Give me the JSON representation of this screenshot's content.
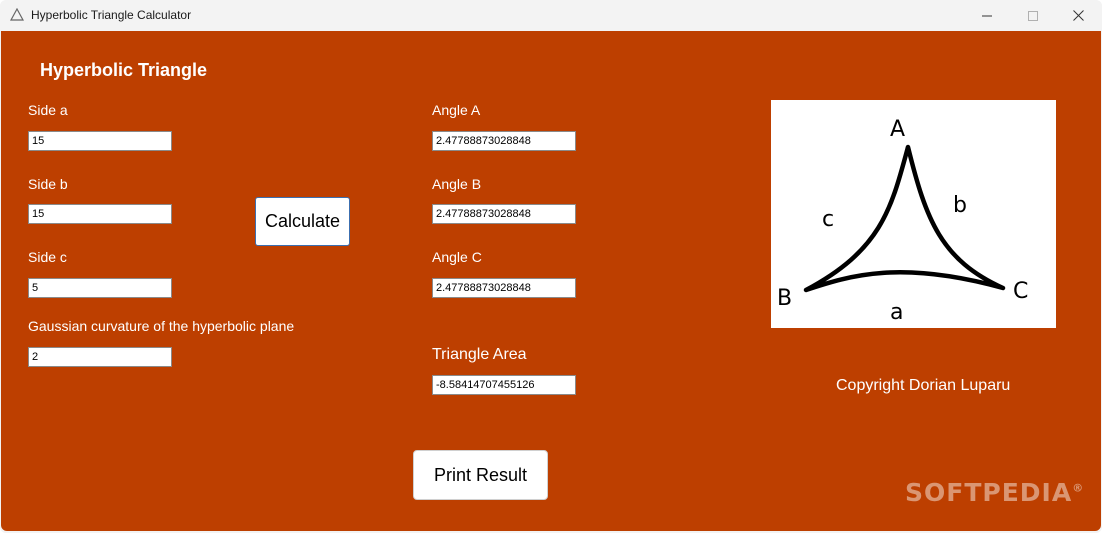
{
  "window": {
    "title": "Hyperbolic Triangle Calculator"
  },
  "heading": "Hyperbolic Triangle",
  "inputs": {
    "side_a": {
      "label": "Side a",
      "value": "15"
    },
    "side_b": {
      "label": "Side b",
      "value": "15"
    },
    "side_c": {
      "label": "Side c",
      "value": "5"
    },
    "curvature": {
      "label": "Gaussian curvature of the hyperbolic plane",
      "value": "2"
    }
  },
  "outputs": {
    "angle_a": {
      "label": "Angle A",
      "value": "2.47788873028848"
    },
    "angle_b": {
      "label": "Angle B",
      "value": "2.47788873028848"
    },
    "angle_c": {
      "label": "Angle C",
      "value": "2.47788873028848"
    },
    "area": {
      "label": "Triangle Area",
      "value": "-8.58414707455126"
    }
  },
  "buttons": {
    "calculate": "Calculate",
    "print": "Print Result"
  },
  "diagram": {
    "vertex_a": "A",
    "vertex_b": "B",
    "vertex_c": "C",
    "side_a": "a",
    "side_b": "b",
    "side_c": "c"
  },
  "copyright": "Copyright Dorian Luparu",
  "watermark": "SOFTPEDIA",
  "watermark_mark": "®",
  "colors": {
    "background": "#bd3f00",
    "text": "#ffffff"
  },
  "icons": [
    "app-icon",
    "minimize-icon",
    "maximize-icon",
    "close-icon"
  ]
}
